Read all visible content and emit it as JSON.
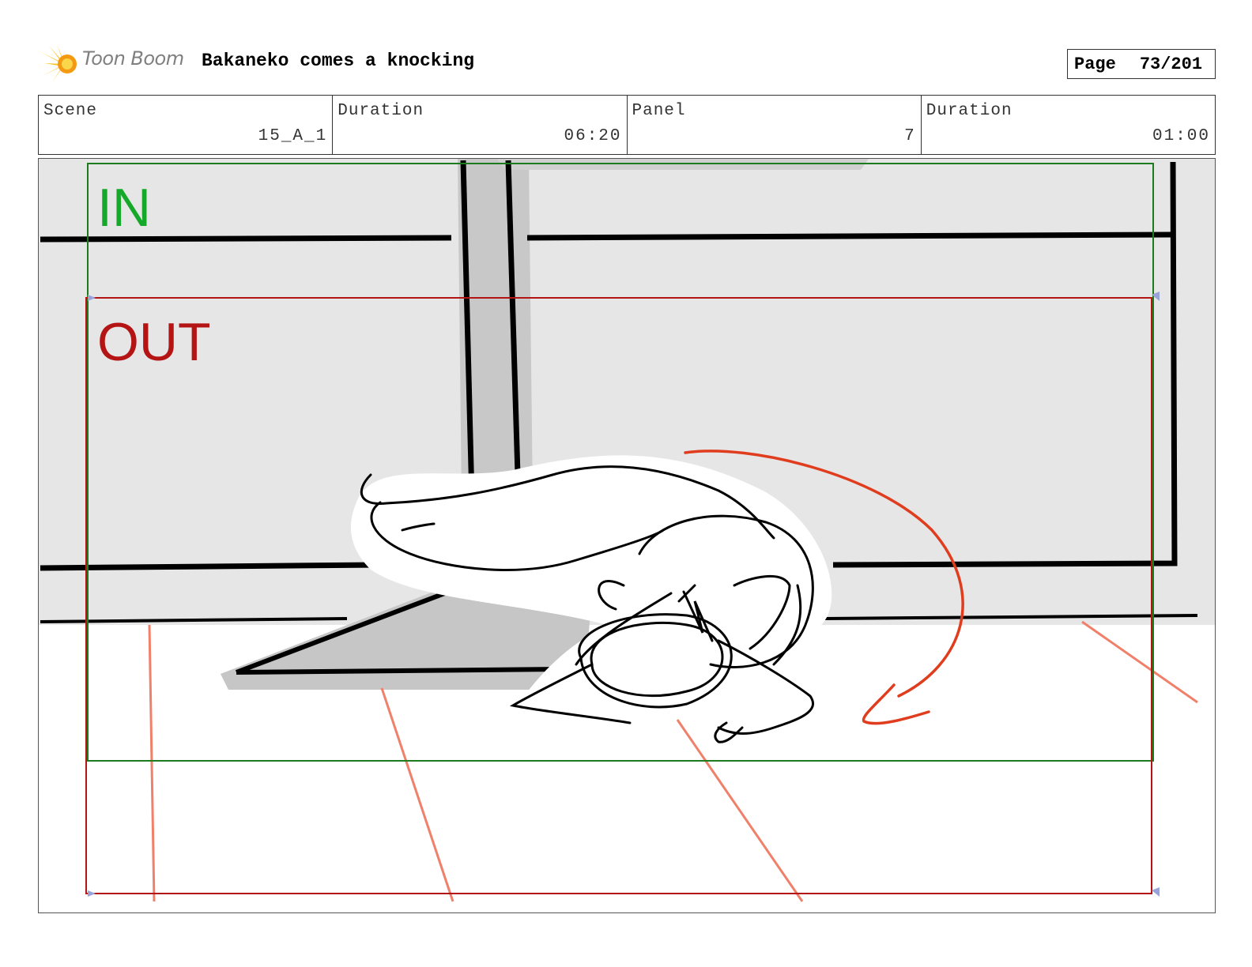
{
  "header": {
    "logo_text": "Toon Boom",
    "title": "Bakaneko comes a knocking",
    "page_label": "Page",
    "page_number": "73/201"
  },
  "info": {
    "scene_label": "Scene",
    "scene_value": "15_A_1",
    "scene_duration_label": "Duration",
    "scene_duration_value": "06:20",
    "panel_label": "Panel",
    "panel_value": "7",
    "panel_duration_label": "Duration",
    "panel_duration_value": "01:00"
  },
  "frame": {
    "in_label": "IN",
    "out_label": "OUT",
    "in_color": "#16a82a",
    "out_color": "#b41414",
    "motion_arrow_color": "#e03c1e"
  }
}
